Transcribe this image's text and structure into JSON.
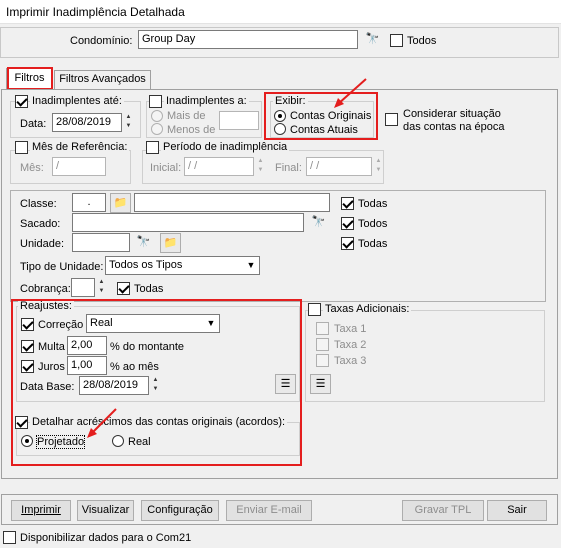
{
  "window": {
    "title": "Imprimir Inadimplência Detalhada"
  },
  "condominio": {
    "label": "Condomínio:",
    "value": "Group Day",
    "todos_label": "Todos",
    "todos_checked": false
  },
  "tabs": [
    {
      "label": "Filtros",
      "active": true
    },
    {
      "label": "Filtros Avançados",
      "active": false
    }
  ],
  "inad_ate": {
    "label": "Inadimplentes até:",
    "checked": true,
    "data_label": "Data:",
    "data_value": "28/08/2019"
  },
  "inad_a": {
    "label": "Inadimplentes a:",
    "checked": false,
    "mais_label": "Mais de",
    "menos_label": "Menos de"
  },
  "exibir": {
    "label": "Exibir:",
    "options": [
      "Contas Originais",
      "Contas Atuais"
    ],
    "selected": "Contas Originais"
  },
  "considerar": {
    "label_line1": "Considerar situação",
    "label_line2": "das contas na época",
    "checked": false
  },
  "mes_ref": {
    "label": "Mês de Referência:",
    "checked": false,
    "mes_label": "Mês:",
    "mes_value": "  /"
  },
  "periodo": {
    "label": "Período de inadimplência",
    "checked": false,
    "inicial_label": "Inicial:",
    "inicial_value": "/ /",
    "final_label": "Final:",
    "final_value": "/ /"
  },
  "classe": {
    "label": "Classe:",
    "code": ".",
    "todas_label": "Todas",
    "todas_checked": true
  },
  "sacado": {
    "label": "Sacado:",
    "todos_label": "Todos",
    "todos_checked": true
  },
  "unidade": {
    "label": "Unidade:",
    "todas_label": "Todas",
    "todas_checked": true
  },
  "tipo_unidade": {
    "label": "Tipo de Unidade:",
    "value": "Todos os Tipos"
  },
  "cobranca": {
    "label": "Cobrança:",
    "todas_label": "Todas",
    "todas_checked": true
  },
  "reajustes": {
    "label": "Reajustes:",
    "correcao": {
      "label": "Correção",
      "checked": true,
      "value": "Real"
    },
    "multa": {
      "label": "Multa",
      "checked": true,
      "value": "2,00",
      "suffix": "% do montante"
    },
    "juros": {
      "label": "Juros",
      "checked": true,
      "value": "1,00",
      "suffix": "% ao mês"
    },
    "data_base": {
      "label": "Data Base:",
      "value": "28/08/2019"
    }
  },
  "taxas": {
    "label": "Taxas Adicionais:",
    "checked": false,
    "items": [
      "Taxa 1",
      "Taxa 2",
      "Taxa 3"
    ]
  },
  "detalhar": {
    "label": "Detalhar acréscimos das contas originais (acordos):",
    "checked": true,
    "options": [
      "Projetado",
      "Real"
    ],
    "selected": "Projetado"
  },
  "buttons": {
    "imprimir": "Imprimir",
    "visualizar": "Visualizar",
    "configuracao": "Configuração",
    "enviar": "Enviar E-mail",
    "gravar": "Gravar TPL",
    "sair": "Sair"
  },
  "com21": {
    "label": "Disponibilizar dados para o Com21",
    "checked": false
  },
  "colors": {
    "highlight": "#e41e1e"
  }
}
